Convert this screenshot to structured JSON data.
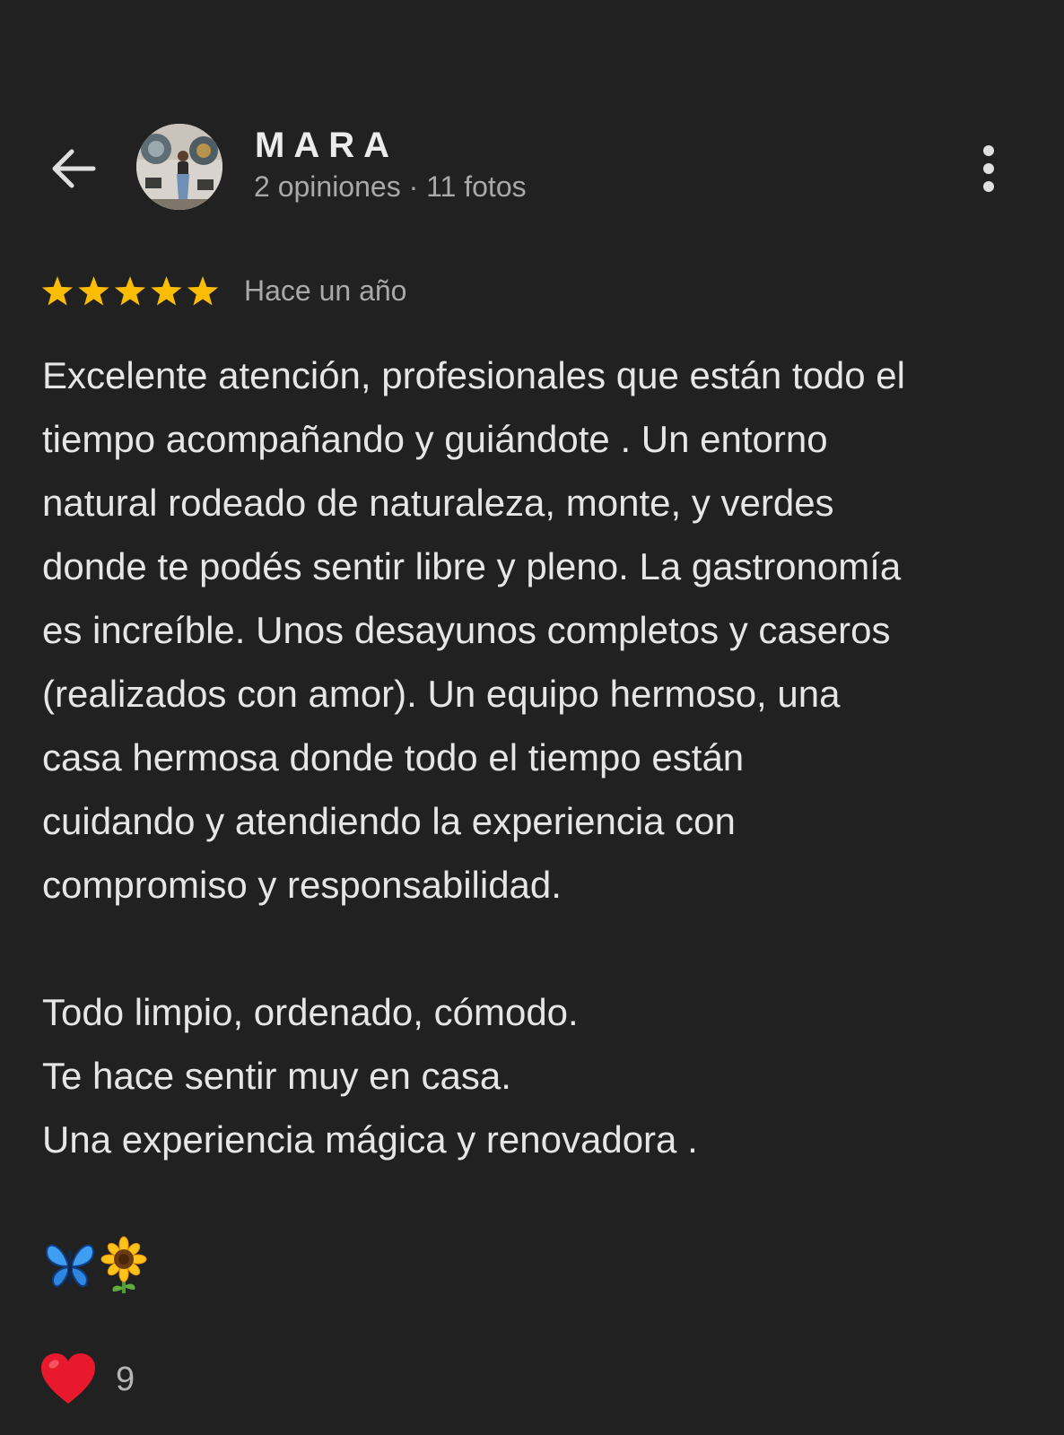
{
  "header": {
    "back_icon": "arrow-left-icon",
    "more_icon": "vertical-dots-icon",
    "user": {
      "name": "MARA",
      "meta": "2 opiniones · 11 fotos",
      "avatar": "profile-photo"
    }
  },
  "review": {
    "rating": 5,
    "rating_max": 5,
    "star_color": "#FBBC04",
    "date": "Hace un año",
    "lines": [
      "Excelente atención, profesionales que están todo el",
      "tiempo acompañando y guiándote . Un entorno",
      "natural rodeado de naturaleza, monte, y verdes",
      "donde te podés sentir libre y pleno. La gastronomía",
      "es increíble. Unos desayunos completos y caseros",
      "(realizados con amor). Un equipo hermoso, una",
      "casa hermosa donde todo el tiempo están",
      "cuidando y atendiendo la experiencia con",
      "compromiso y responsabilidad.",
      "",
      "Todo limpio, ordenado, cómodo.",
      "Te hace sentir muy en casa.",
      "Una experiencia mágica y renovadora ."
    ],
    "emojis": [
      "butterfly-emoji",
      "sunflower-emoji"
    ]
  },
  "reactions": {
    "icon": "heart-icon",
    "heart_color": "#E8192C",
    "count": "9"
  }
}
